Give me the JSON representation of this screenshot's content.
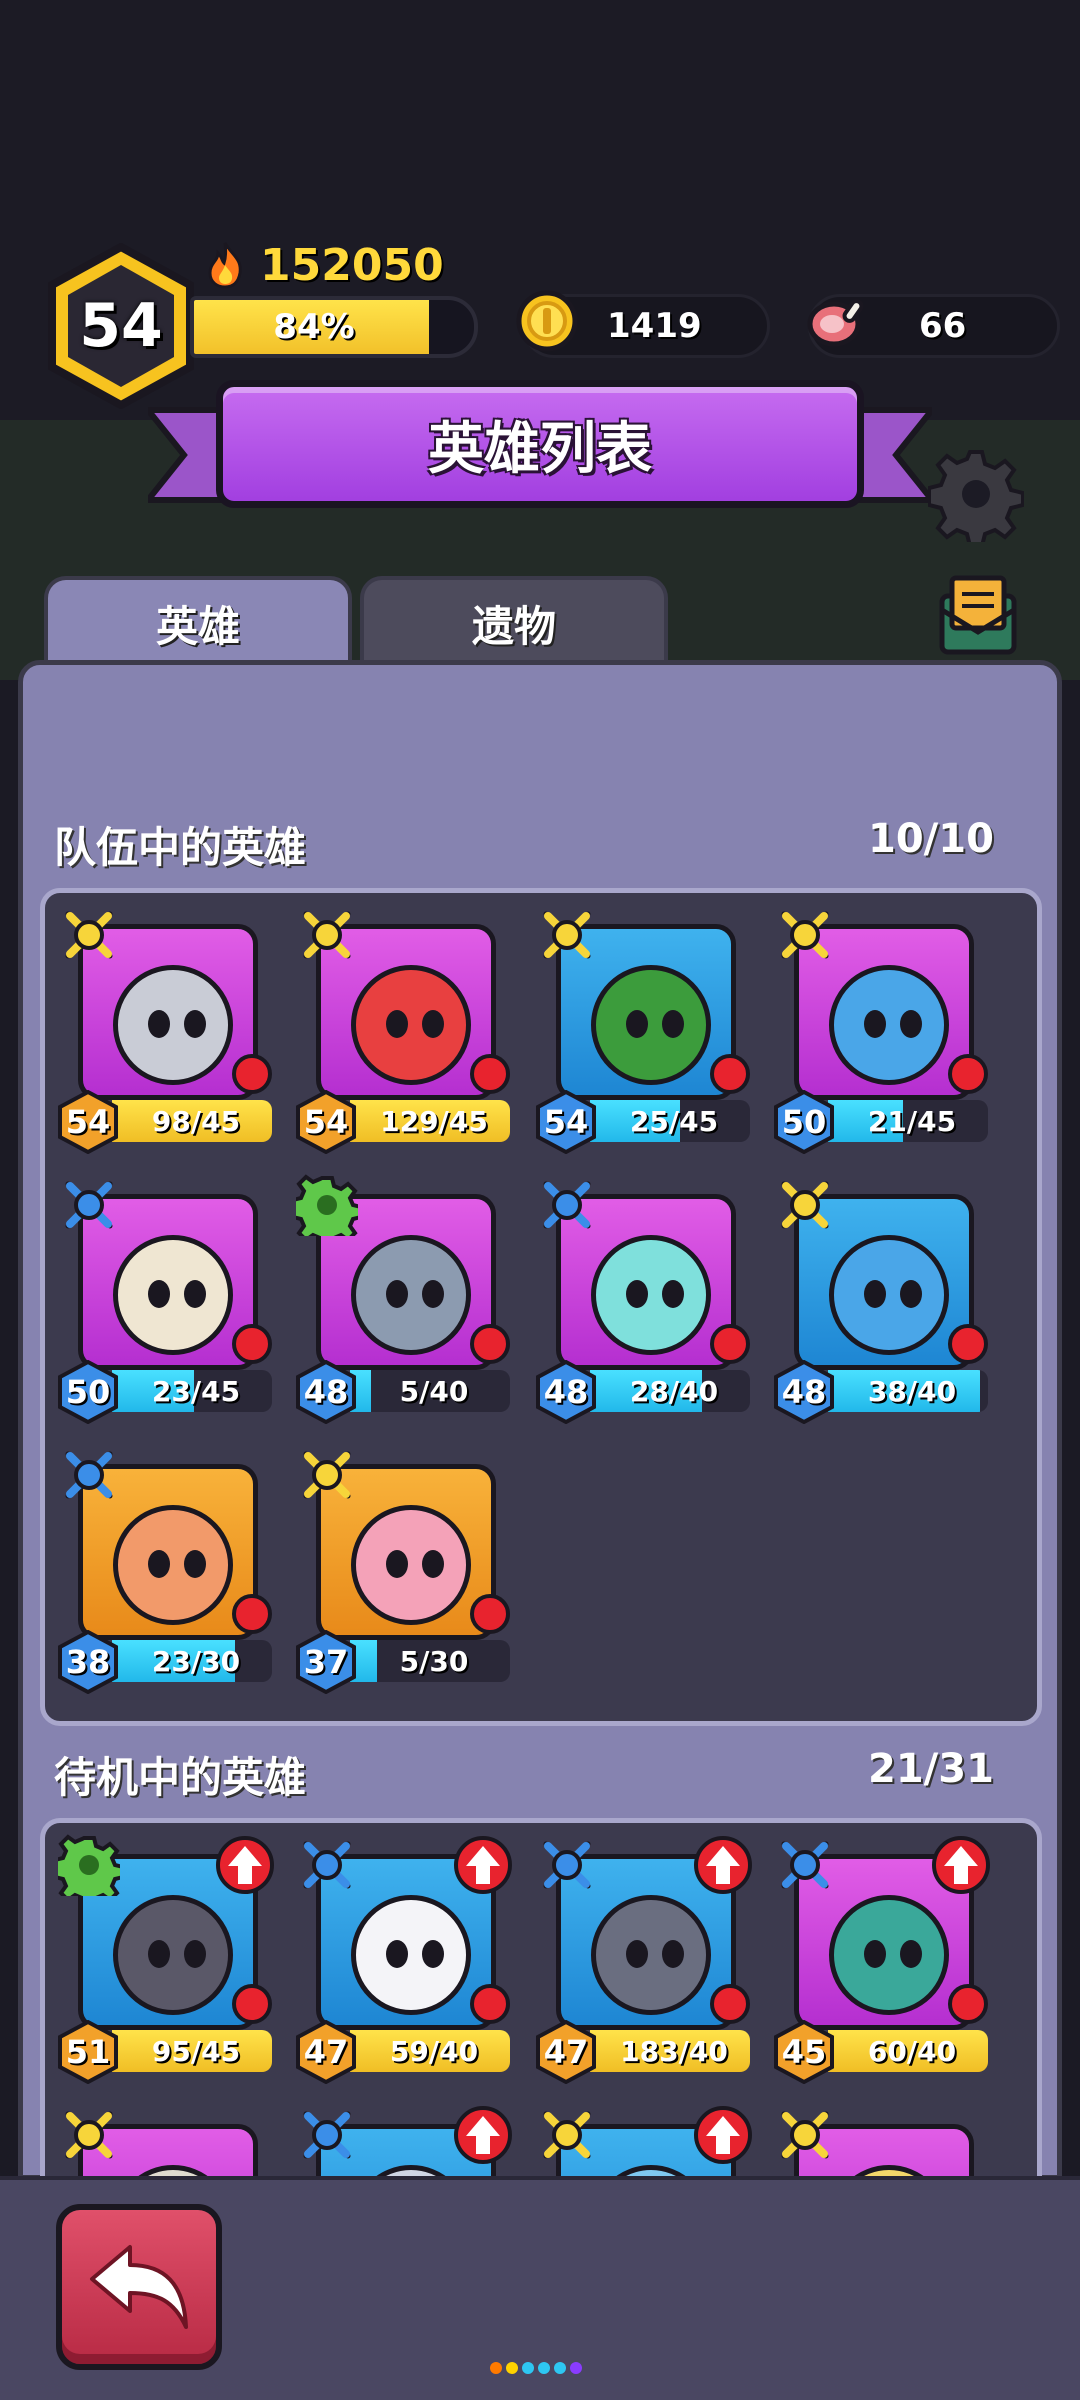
{
  "player": {
    "level": "54",
    "power": "152050",
    "xp_percent": 84,
    "xp_label": "84%"
  },
  "resources": {
    "coins": "1419",
    "meat": "66"
  },
  "header": {
    "title": "英雄列表"
  },
  "tabs": [
    {
      "label": "英雄",
      "active": true
    },
    {
      "label": "遗物",
      "active": false
    }
  ],
  "team": {
    "title": "队伍中的英雄",
    "count": "10/10",
    "heroes": [
      {
        "level": "54",
        "progress": "98/45",
        "fill": 1.0,
        "bar": "gold",
        "bg": "purple",
        "rank": "gold-cross",
        "face": "#c9ccd6"
      },
      {
        "level": "54",
        "progress": "129/45",
        "fill": 1.0,
        "bar": "gold",
        "bg": "purple",
        "rank": "gold-cross",
        "face": "#e84040"
      },
      {
        "level": "54",
        "progress": "25/45",
        "fill": 0.56,
        "bar": "cyan",
        "bg": "blue",
        "rank": "gold-cross",
        "face": "#3c9c3c"
      },
      {
        "level": "50",
        "progress": "21/45",
        "fill": 0.47,
        "bar": "cyan",
        "bg": "purple",
        "rank": "gold-cross",
        "face": "#4aa6e8"
      },
      {
        "level": "50",
        "progress": "23/45",
        "fill": 0.51,
        "bar": "cyan",
        "bg": "purple",
        "rank": "blue-cross",
        "face": "#efe6d2"
      },
      {
        "level": "48",
        "progress": "5/40",
        "fill": 0.13,
        "bar": "cyan",
        "bg": "purple",
        "rank": "green-gear",
        "face": "#8c9bb0"
      },
      {
        "level": "48",
        "progress": "28/40",
        "fill": 0.7,
        "bar": "cyan",
        "bg": "purple",
        "rank": "blue-cross",
        "face": "#7fe0dc"
      },
      {
        "level": "48",
        "progress": "38/40",
        "fill": 0.95,
        "bar": "cyan",
        "bg": "blue",
        "rank": "gold-cross",
        "face": "#4aa6e8"
      },
      {
        "level": "38",
        "progress": "23/30",
        "fill": 0.77,
        "bar": "cyan",
        "bg": "orange",
        "rank": "blue-cross",
        "face": "#f29a6a"
      },
      {
        "level": "37",
        "progress": "5/30",
        "fill": 0.17,
        "bar": "cyan",
        "bg": "orange",
        "rank": "gold-cross",
        "face": "#f4a2b8"
      }
    ]
  },
  "idle": {
    "title": "待机中的英雄",
    "count": "21/31",
    "heroes": [
      {
        "level": "51",
        "progress": "95/45",
        "fill": 1.0,
        "bar": "gold",
        "bg": "blue",
        "rank": "green-gear",
        "face": "#5a5868",
        "upgrade": true
      },
      {
        "level": "47",
        "progress": "59/40",
        "fill": 1.0,
        "bar": "gold",
        "bg": "blue",
        "rank": "blue-cross",
        "face": "#f4f4f8",
        "upgrade": true
      },
      {
        "level": "47",
        "progress": "183/40",
        "fill": 1.0,
        "bar": "gold",
        "bg": "blue",
        "rank": "blue-cross",
        "face": "#6a6e80",
        "upgrade": true
      },
      {
        "level": "45",
        "progress": "60/40",
        "fill": 1.0,
        "bar": "gold",
        "bg": "purple",
        "rank": "blue-cross",
        "face": "#3aa89a",
        "upgrade": true
      },
      {
        "bg": "purple",
        "rank": "gold-cross",
        "face": "#e0dcd0",
        "upgrade": false
      },
      {
        "bg": "blue",
        "rank": "blue-cross",
        "face": "#cfd6e4",
        "upgrade": true
      },
      {
        "bg": "blue",
        "rank": "gold-cross",
        "face": "#7fc8f0",
        "upgrade": true
      },
      {
        "bg": "purple",
        "rank": "gold-cross",
        "face": "#f4d86a",
        "upgrade": false
      }
    ]
  },
  "colors": {
    "accent_purple": "#b04de6",
    "gold": "#ffd93b",
    "cyan": "#2ec7f2",
    "panel": "#8683b0"
  },
  "page_dots": [
    "#ff7a00",
    "#ffd200",
    "#2ec7f2",
    "#2ec7f2",
    "#2ec7f2",
    "#8a3cff"
  ]
}
